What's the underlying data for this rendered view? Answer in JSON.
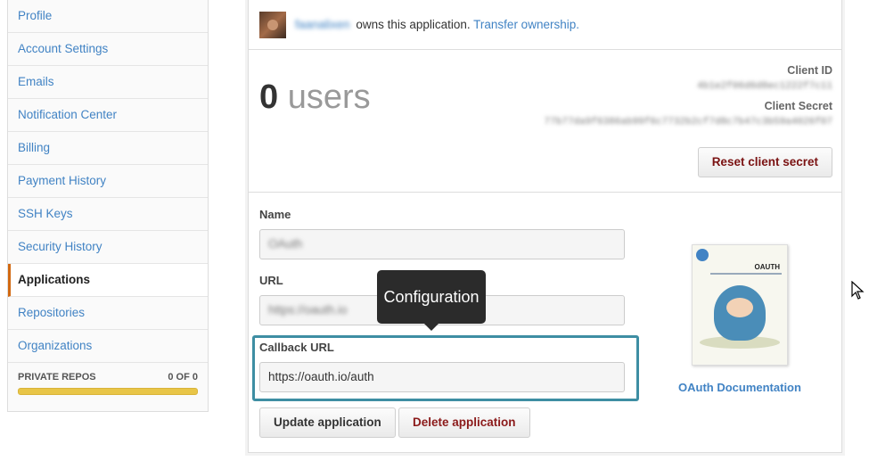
{
  "sidebar": {
    "items": [
      {
        "label": "Profile",
        "active": false
      },
      {
        "label": "Account Settings",
        "active": false
      },
      {
        "label": "Emails",
        "active": false
      },
      {
        "label": "Notification Center",
        "active": false
      },
      {
        "label": "Billing",
        "active": false
      },
      {
        "label": "Payment History",
        "active": false
      },
      {
        "label": "SSH Keys",
        "active": false
      },
      {
        "label": "Security History",
        "active": false
      },
      {
        "label": "Applications",
        "active": true
      },
      {
        "label": "Repositories",
        "active": false
      },
      {
        "label": "Organizations",
        "active": false
      }
    ],
    "private_repos": {
      "label": "PRIVATE REPOS",
      "count": "0 OF 0",
      "progress": 1.0,
      "bar_color": "#e8c547"
    }
  },
  "owner": {
    "username": "faanalixen",
    "text": "owns this application.",
    "transfer_link": "Transfer ownership."
  },
  "stats": {
    "count": "0",
    "unit": "users"
  },
  "client": {
    "id_label": "Client ID",
    "id_value": "4b1e2f06d6d8ec1222f7c11",
    "secret_label": "Client Secret",
    "secret_value": "77b77da9f6386ab99f6c7732b2cf7d8c7b47c3b59a4026f07",
    "reset_button": "Reset client secret"
  },
  "form": {
    "name_label": "Name",
    "name_value": "OAuth",
    "url_label": "URL",
    "url_value": "https://oauth.io",
    "callback_label": "Callback URL",
    "callback_value": "https://oauth.io/auth",
    "update_button": "Update application",
    "delete_button": "Delete application"
  },
  "tooltip": {
    "text": "Configuration"
  },
  "book": {
    "title": "OAUTH",
    "caption": "OAuth Documentation"
  },
  "colors": {
    "link": "#4183c4",
    "active_indicator": "#d26911",
    "highlight_border": "#3e8ea3",
    "danger_text": "#8b1a1a"
  }
}
